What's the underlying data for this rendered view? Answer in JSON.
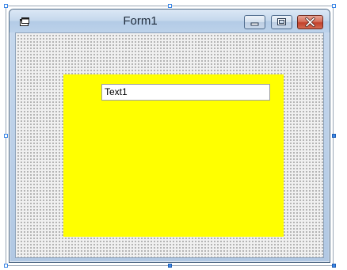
{
  "window": {
    "title": "Form1",
    "system_icon": "form-icon",
    "buttons": {
      "minimize": "minimize-icon",
      "maximize": "maximize-icon",
      "close": "close-icon"
    }
  },
  "form": {
    "grid": "dotted",
    "panel": {
      "color": "#ffff00"
    },
    "textbox": {
      "value": "Text1"
    }
  },
  "colors": {
    "selection_handle": "#3b86e6",
    "close_button": "#c2412b"
  }
}
